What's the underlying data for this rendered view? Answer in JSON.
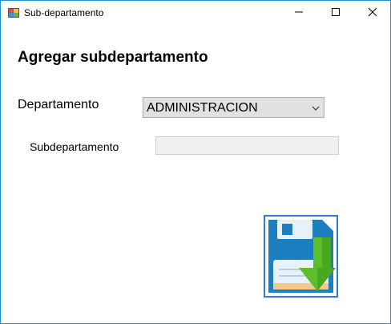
{
  "window": {
    "title": "Sub-departamento"
  },
  "form": {
    "heading": "Agregar subdepartamento",
    "departamento_label": "Departamento",
    "departamento_value": "ADMINISTRACION",
    "subdepartamento_label": "Subdepartamento",
    "subdepartamento_value": ""
  },
  "icons": {
    "app": "app-form-icon",
    "minimize": "minimize-icon",
    "maximize": "maximize-icon",
    "close": "close-icon",
    "dropdown": "chevron-down-icon",
    "save": "floppy-save-icon"
  },
  "colors": {
    "window_border": "#1a8fd6",
    "combo_bg": "#e1e1e1",
    "textbox_bg": "#f0f0f0",
    "floppy_blue": "#1e7fc0",
    "arrow_green": "#5cbf2a"
  }
}
